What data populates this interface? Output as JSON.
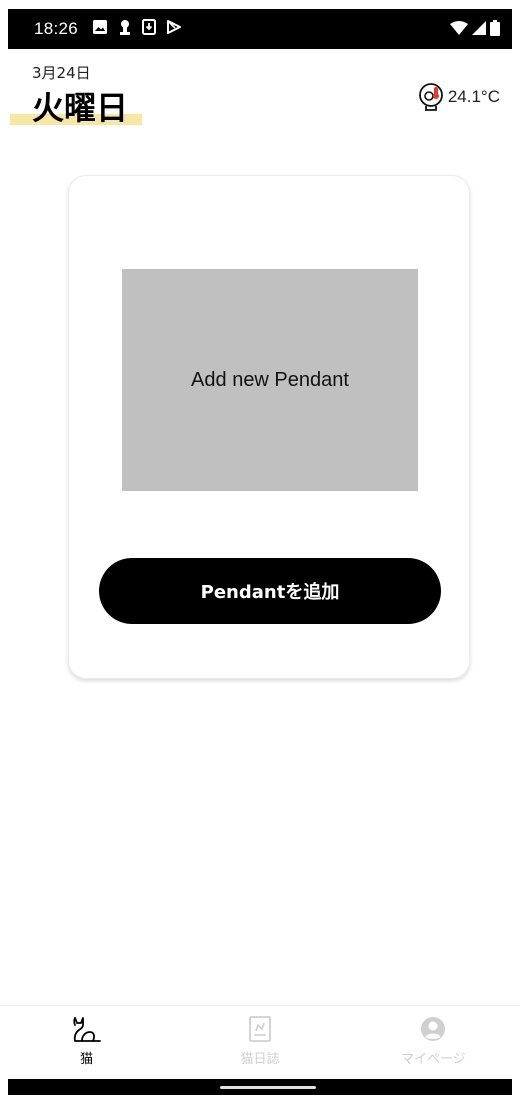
{
  "status_bar": {
    "time": "18:26"
  },
  "header": {
    "date": "3月24日",
    "weekday": "火曜日",
    "temperature": "24.1°C",
    "highlight_color": "#f6e7a3"
  },
  "card": {
    "placeholder_text": "Add new Pendant",
    "button_label": "Pendantを追加"
  },
  "bottom_nav": {
    "items": [
      {
        "label": "猫",
        "icon": "cat-icon",
        "active": true
      },
      {
        "label": "猫日誌",
        "icon": "diary-icon",
        "active": false
      },
      {
        "label": "マイページ",
        "icon": "account-icon",
        "active": false
      }
    ]
  }
}
